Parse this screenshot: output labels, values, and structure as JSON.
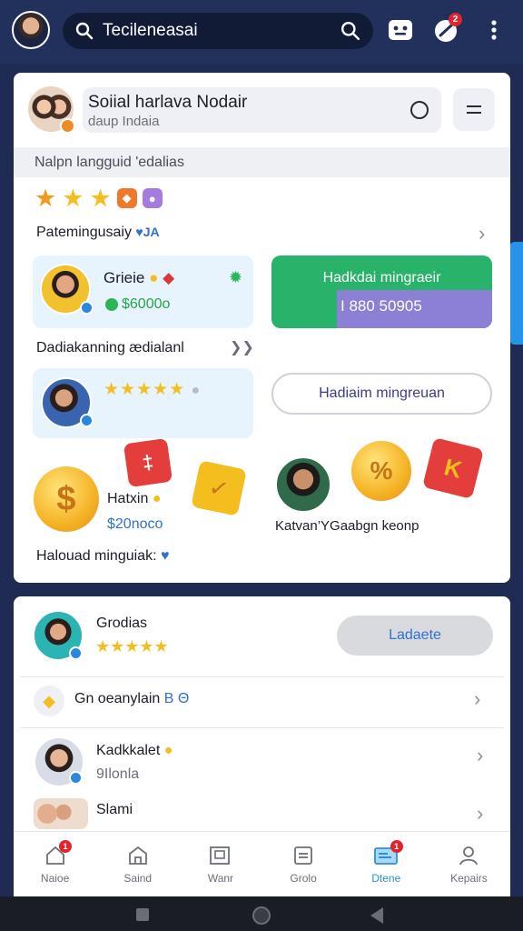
{
  "topbar": {
    "search_text": "Tecileneasai",
    "notification_count": "2"
  },
  "profile": {
    "title": "Soiial harlava Nodair",
    "subtitle": "daup Indaia"
  },
  "language_bar": {
    "text": "Nalpn langguid 'edalias"
  },
  "patterning": {
    "label": "Patemingusaiy",
    "tag": "♥JA"
  },
  "user1": {
    "name": "Grieie",
    "amount": "$6000o"
  },
  "green_button": {
    "line1": "Hadkdai mingraeir",
    "line2": "I 880 50905"
  },
  "section": {
    "label": "Dadiakanning ædialanl"
  },
  "outline_button": {
    "label": "Hadiaim mingreuan"
  },
  "promo": {
    "name": "Hatxin",
    "amount": "$20noco",
    "right_caption": "Katvan’YGaabgn keonp"
  },
  "bottom_line": {
    "text": "Halouad minguiak:"
  },
  "list": {
    "row1": {
      "name": "Grodias",
      "button": "Ladaete"
    },
    "row2": {
      "text": "Gn oeanylain",
      "suffix": "B Θ"
    },
    "row3": {
      "name": "Kadkkalet",
      "sub": "9Ilonla"
    },
    "row4": {
      "name": "Slami"
    }
  },
  "tabs": [
    {
      "label": "Naioe",
      "badge": "1"
    },
    {
      "label": "Saind"
    },
    {
      "label": "Wanr"
    },
    {
      "label": "Grolo"
    },
    {
      "label": "Dtene",
      "badge": "1"
    },
    {
      "label": "Kepairs"
    }
  ],
  "colors": {
    "accent": "#2f6fd6",
    "green": "#29b36a",
    "purple": "#8b7fd6",
    "header": "#22305c"
  }
}
